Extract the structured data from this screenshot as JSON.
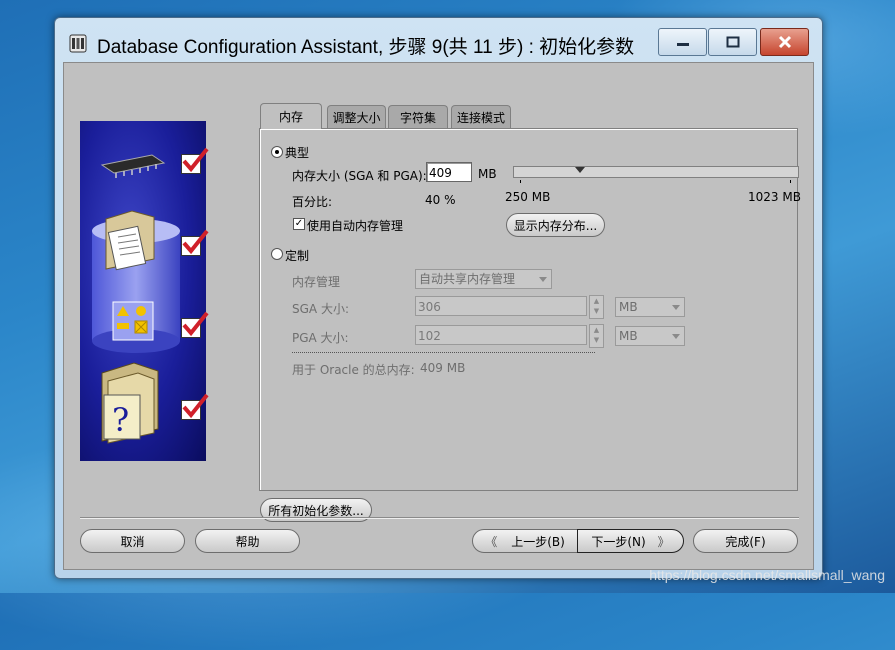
{
  "window": {
    "title": "Database Configuration Assistant, 步骤 9(共 11 步) : 初始化参数",
    "controls": {
      "minimize": "minimize",
      "maximize": "maximize",
      "close": "close"
    }
  },
  "tabs": [
    {
      "label": "内存",
      "active": true
    },
    {
      "label": "调整大小",
      "active": false
    },
    {
      "label": "字符集",
      "active": false
    },
    {
      "label": "连接模式",
      "active": false
    }
  ],
  "memory": {
    "typical": {
      "label": "典型",
      "selected": true,
      "size_label": "内存大小 (SGA 和 PGA):",
      "size_value": "409",
      "size_unit": "MB",
      "slider": {
        "min_label": "250 MB",
        "max_label": "1023 MB"
      },
      "percent_label": "百分比:",
      "percent_value": "40 %",
      "auto_mem_label": "使用自动内存管理",
      "auto_mem_checked": true,
      "show_dist_button": "显示内存分布..."
    },
    "custom": {
      "label": "定制",
      "selected": false,
      "mgmt_label": "内存管理",
      "mgmt_value": "自动共享内存管理",
      "sga_label": "SGA 大小:",
      "sga_value": "306",
      "sga_unit": "MB",
      "pga_label": "PGA 大小:",
      "pga_value": "102",
      "pga_unit": "MB",
      "total_label": "用于 Oracle 的总内存:",
      "total_value": "409 MB"
    }
  },
  "buttons": {
    "all_params": "所有初始化参数...",
    "cancel": "取消",
    "help": "帮助",
    "back": "上一步(B)",
    "next": "下一步(N)",
    "finish": "完成(F)"
  },
  "watermark": "https://blog.csdn.net/smallsmall_wang",
  "colors": {
    "side_panel": "#1a1e9a",
    "check_red": "#d0202a",
    "dialog_bg": "#c0c0c0"
  }
}
